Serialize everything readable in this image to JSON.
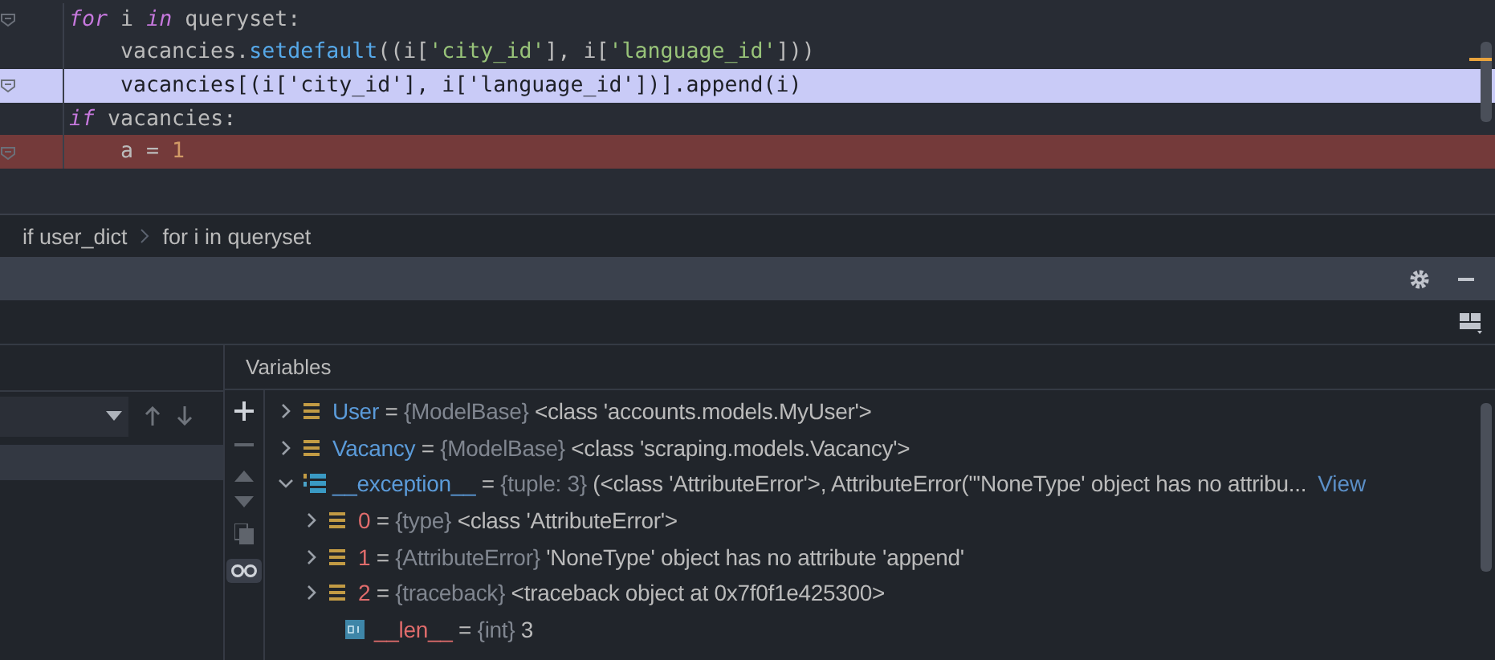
{
  "editor": {
    "lines": [
      {
        "current": false,
        "breakpoint": false,
        "fold": true,
        "tokens": [
          {
            "text": "for",
            "kind": "keyword"
          },
          {
            "text": " i ",
            "kind": "plain"
          },
          {
            "text": "in",
            "kind": "keyword"
          },
          {
            "text": " queryset:",
            "kind": "plain"
          }
        ],
        "children": [
          {
            "current": false,
            "breakpoint": false,
            "fold": false,
            "tokens": [
              {
                "text": "vacancies.",
                "kind": "plain"
              },
              {
                "text": "setdefault",
                "kind": "func"
              },
              {
                "text": "((i[",
                "kind": "plain"
              },
              {
                "text": "'city_id'",
                "kind": "string"
              },
              {
                "text": "], i[",
                "kind": "plain"
              },
              {
                "text": "'language_id'",
                "kind": "string"
              },
              {
                "text": "]))",
                "kind": "plain"
              }
            ]
          },
          {
            "current": true,
            "breakpoint": false,
            "fold": true,
            "tokens": [
              {
                "text": "vacancies[(i['city_id'], i['language_id'])].append(i)",
                "kind": "plain"
              }
            ]
          }
        ]
      },
      {
        "current": false,
        "breakpoint": false,
        "fold": false,
        "tokens": [
          {
            "text": "if",
            "kind": "keyword"
          },
          {
            "text": " vacancies:",
            "kind": "plain"
          }
        ],
        "children": [
          {
            "current": false,
            "breakpoint": true,
            "fold": true,
            "tokens": [
              {
                "text": "a = ",
                "kind": "plain"
              },
              {
                "text": "1",
                "kind": "number"
              }
            ]
          }
        ]
      }
    ]
  },
  "breadcrumbs": [
    "if user_dict",
    "for i in queryset"
  ],
  "variables_panel": {
    "title": "Variables",
    "variables": [
      {
        "name": "User",
        "separator": "=",
        "type": "{ModelBase}",
        "value": "<class 'accounts.models.MyUser'>",
        "kind": "object",
        "expanded": false,
        "color": "#5b9bd9"
      },
      {
        "name": "Vacancy",
        "separator": "=",
        "type": "{ModelBase}",
        "value": "<class 'scraping.models.Vacancy'>",
        "kind": "object",
        "expanded": false,
        "color": "#5b9bd9"
      },
      {
        "name": "__exception__",
        "separator": "=",
        "type": "{tuple: 3}",
        "value": "(<class 'AttributeError'>, AttributeError(\"'NoneType' object has no attribu...",
        "link": "View",
        "kind": "tuple",
        "expanded": true,
        "color": "#5b9bd9",
        "children": [
          {
            "name": "0",
            "separator": "=",
            "type": "{type}",
            "value": "<class 'AttributeError'>",
            "kind": "object",
            "expanded": false,
            "color": "#e06c6c"
          },
          {
            "name": "1",
            "separator": "=",
            "type": "{AttributeError}",
            "value": "'NoneType' object has no attribute 'append'",
            "kind": "object",
            "expanded": false,
            "color": "#e06c6c"
          },
          {
            "name": "2",
            "separator": "=",
            "type": "{traceback}",
            "value": "<traceback object at 0x7f0f1e425300>",
            "kind": "object",
            "expanded": false,
            "color": "#e06c6c"
          },
          {
            "name": "__len__",
            "separator": "=",
            "type": "{int}",
            "value": "3",
            "kind": "int",
            "color": "#e06c6c"
          }
        ]
      }
    ]
  }
}
